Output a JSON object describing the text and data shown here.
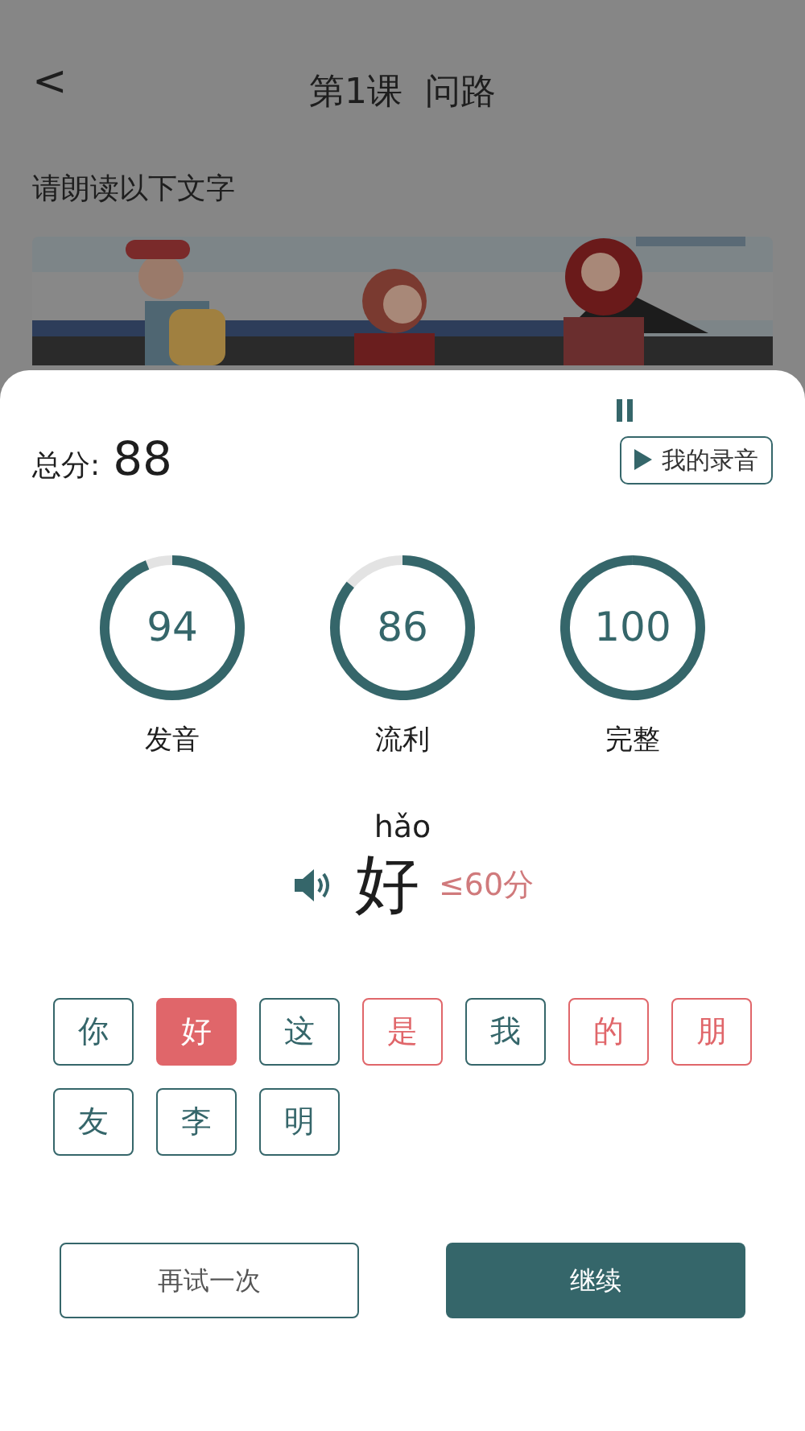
{
  "header": {
    "back": "<",
    "title": "第1课  问路"
  },
  "instruction": "请朗读以下文字",
  "result": {
    "total_label": "总分:",
    "total": "88",
    "recording_button": "我的录音",
    "playing": true,
    "scores": [
      {
        "value": "94",
        "label": "发音",
        "level": 0.94
      },
      {
        "value": "86",
        "label": "流利",
        "level": 0.86
      },
      {
        "value": "100",
        "label": "完整",
        "level": 1
      }
    ],
    "focus": {
      "pinyin": "hǎo",
      "character": "好",
      "note": "≤60分"
    },
    "characters": [
      {
        "text": "你",
        "color": "#35666a",
        "selected": false
      },
      {
        "text": "好",
        "color": "#e0666a",
        "selected": true
      },
      {
        "text": "这",
        "color": "#35666a",
        "selected": false
      },
      {
        "text": "是",
        "color": "#e0666a",
        "selected": false
      },
      {
        "text": "我",
        "color": "#35666a",
        "selected": false
      },
      {
        "text": "的",
        "color": "#e0666a",
        "selected": false
      },
      {
        "text": "朋",
        "color": "#e0666a",
        "selected": false
      },
      {
        "text": "友",
        "color": "#35666a",
        "selected": false
      },
      {
        "text": "李",
        "color": "#35666a",
        "selected": false
      },
      {
        "text": "明",
        "color": "#35666a",
        "selected": false
      }
    ],
    "buttons": [
      {
        "label": "再试一次",
        "kind": "outline"
      },
      {
        "label": "继续",
        "kind": "primary"
      }
    ]
  }
}
